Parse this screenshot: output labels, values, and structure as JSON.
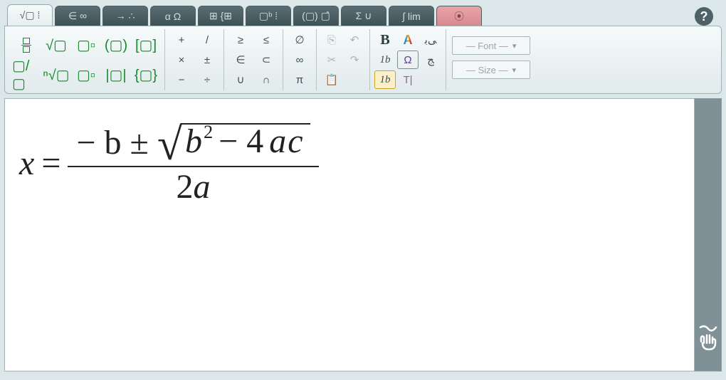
{
  "tabs": [
    {
      "label": "√▢ ⁞"
    },
    {
      "label": "∈ ∞"
    },
    {
      "label": "→ ∴"
    },
    {
      "label": "α Ω"
    },
    {
      "label": "⊞ {⊞"
    },
    {
      "label": "▢ᵇ ⁞"
    },
    {
      "label": "(▢) ▢̂"
    },
    {
      "label": "Σ ∪"
    },
    {
      "label": "∫ lim"
    },
    {
      "label": "⦿"
    }
  ],
  "templates": {
    "frac": "▢/▢",
    "sqrt": "√▢",
    "sup": "▢▫",
    "paren": "(▢)",
    "bracket": "[▢]",
    "mixed": "▢/▢",
    "nroot": "ⁿ√▢",
    "sub": "▢▫",
    "abs": "|▢|",
    "brace": "{▢}"
  },
  "ops": {
    "plus": "+",
    "slash": "/",
    "times": "×",
    "pm": "±",
    "minus": "−",
    "div": "÷"
  },
  "rel": {
    "ge": "≥",
    "le": "≤",
    "in": "∈",
    "subset": "⊂",
    "union": "∪",
    "intersect": "∩"
  },
  "sym": {
    "empty": "∅",
    "inf": "∞",
    "pi": "π"
  },
  "clip": {
    "copy": "⎘",
    "undo": "↶",
    "cut": "✂",
    "redo": "↷",
    "paste": "📋",
    "paste2": ""
  },
  "style": {
    "bold": "B",
    "color": "A",
    "arabic": "ﻰﺑ",
    "italic": "1b",
    "omega": "Ω",
    "arabic2": "ﺞ",
    "italic2": "1b",
    "cursor": "T|"
  },
  "dropdowns": {
    "font": "— Font —",
    "size": "— Size —"
  },
  "formula": {
    "lhs": "x",
    "eq": "=",
    "num_prefix": "− b ±",
    "sqrt_b": "b",
    "sqrt_exp": "2",
    "sqrt_mid": "− 4",
    "sqrt_a": "a",
    "sqrt_c": "c",
    "den_2": "2",
    "den_a": "a"
  }
}
